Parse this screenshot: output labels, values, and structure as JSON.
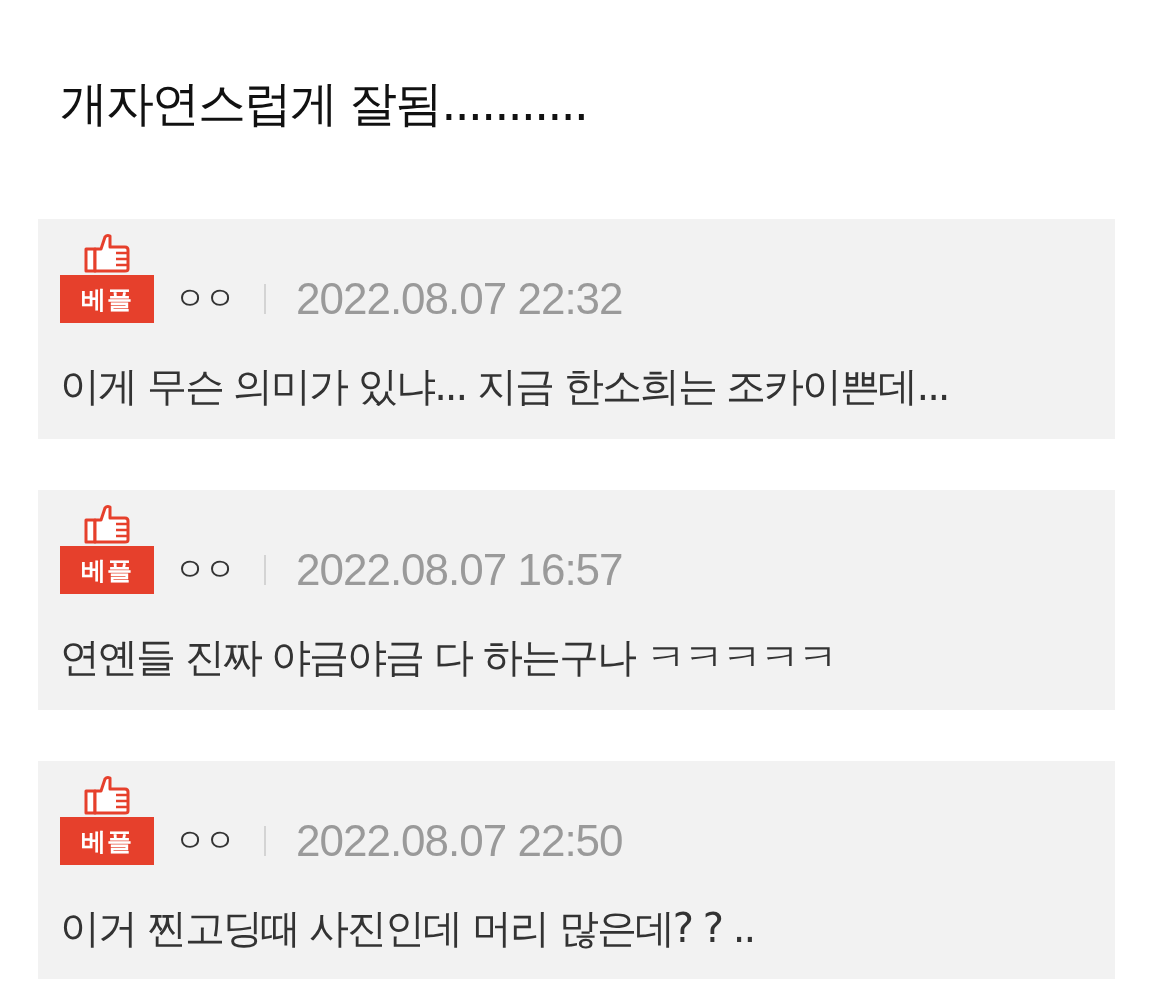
{
  "title": "개자연스럽게 잘됨...........",
  "comments": [
    {
      "badge": "베플",
      "author": "ㅇㅇ",
      "date": "2022.08.07 22:32",
      "text": "이게 무슨 의미가 있냐... 지금 한소희는 조카이쁜데..."
    },
    {
      "badge": "베플",
      "author": "ㅇㅇ",
      "date": "2022.08.07 16:57",
      "text": "연옌들 진짜 야금야금 다 하는구나 ㅋㅋㅋㅋㅋ"
    },
    {
      "badge": "베플",
      "author": "ㅇㅇ",
      "date": "2022.08.07 22:50",
      "text": "이거 찐고딩때 사진인데 머리 많은데? ? .."
    }
  ]
}
